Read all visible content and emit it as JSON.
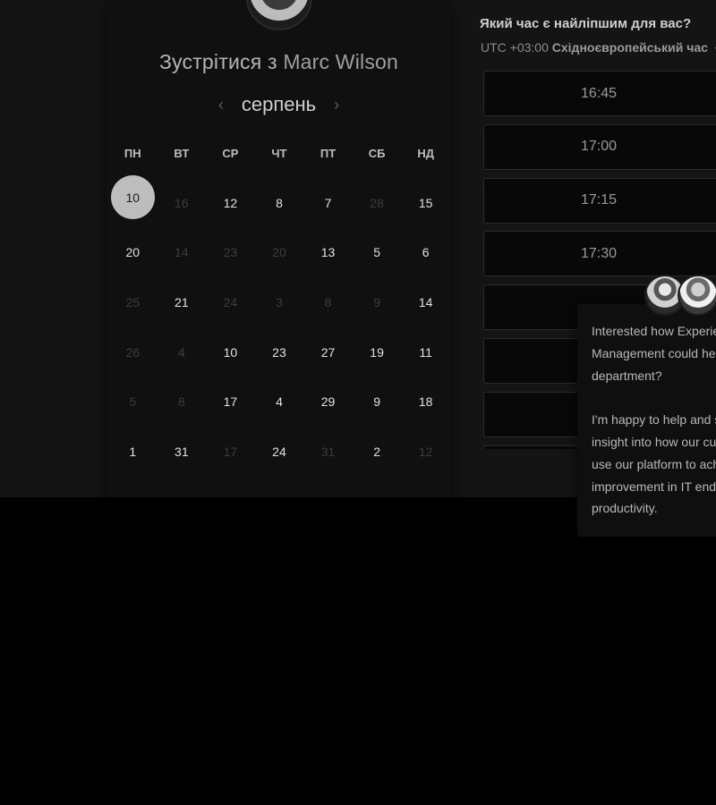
{
  "calendar": {
    "title_prefix": "Зустрітися з",
    "host_name": "Marc Wilson",
    "month": "серпень",
    "prev_label": "‹",
    "next_label": "›",
    "weekdays": [
      "ПН",
      "ВТ",
      "СР",
      "ЧТ",
      "ПТ",
      "СБ",
      "НД"
    ],
    "weeks": [
      [
        {
          "d": "10",
          "s": "selected"
        },
        {
          "d": "16",
          "s": "unavailable"
        },
        {
          "d": "12",
          "s": "available"
        },
        {
          "d": "8",
          "s": "available"
        },
        {
          "d": "7",
          "s": "available"
        },
        {
          "d": "28",
          "s": "unavailable"
        },
        {
          "d": "15",
          "s": "available"
        }
      ],
      [
        {
          "d": "20",
          "s": "available"
        },
        {
          "d": "14",
          "s": "unavailable"
        },
        {
          "d": "23",
          "s": "unavailable"
        },
        {
          "d": "20",
          "s": "unavailable"
        },
        {
          "d": "13",
          "s": "available"
        },
        {
          "d": "5",
          "s": "available"
        },
        {
          "d": "6",
          "s": "available"
        }
      ],
      [
        {
          "d": "25",
          "s": "unavailable"
        },
        {
          "d": "21",
          "s": "available"
        },
        {
          "d": "24",
          "s": "unavailable"
        },
        {
          "d": "3",
          "s": "unavailable"
        },
        {
          "d": "8",
          "s": "unavailable"
        },
        {
          "d": "9",
          "s": "unavailable"
        },
        {
          "d": "14",
          "s": "available"
        }
      ],
      [
        {
          "d": "26",
          "s": "unavailable"
        },
        {
          "d": "4",
          "s": "unavailable"
        },
        {
          "d": "10",
          "s": "available"
        },
        {
          "d": "23",
          "s": "available"
        },
        {
          "d": "27",
          "s": "available"
        },
        {
          "d": "19",
          "s": "available"
        },
        {
          "d": "11",
          "s": "available"
        }
      ],
      [
        {
          "d": "5",
          "s": "unavailable"
        },
        {
          "d": "8",
          "s": "unavailable"
        },
        {
          "d": "17",
          "s": "available"
        },
        {
          "d": "4",
          "s": "available"
        },
        {
          "d": "29",
          "s": "available"
        },
        {
          "d": "9",
          "s": "available"
        },
        {
          "d": "18",
          "s": "available"
        }
      ],
      [
        {
          "d": "1",
          "s": "available"
        },
        {
          "d": "31",
          "s": "available"
        },
        {
          "d": "17",
          "s": "unavailable"
        },
        {
          "d": "24",
          "s": "available"
        },
        {
          "d": "31",
          "s": "unavailable"
        },
        {
          "d": "2",
          "s": "available"
        },
        {
          "d": "12",
          "s": "unavailable"
        }
      ]
    ]
  },
  "times": {
    "question": "Який час є найліпшим для вас?",
    "timezone_offset": "UTC +03:00",
    "timezone_name": "Східноєвропейський час",
    "timezone_caret": "▾",
    "slots": [
      "16:45",
      "17:00",
      "17:15",
      "17:30",
      "",
      "",
      "",
      ""
    ]
  },
  "chat": {
    "lines_1": [
      "Interested how Experie",
      "Management could hel",
      "department?"
    ],
    "lines_2": [
      "I'm happy to help and s",
      "insight into how our cus",
      "use our platform to ach",
      "improvement in IT end-",
      "productivity."
    ]
  },
  "colors": {
    "background": "#000000",
    "card": "#101010",
    "selected_day": "#bdbdbd"
  }
}
